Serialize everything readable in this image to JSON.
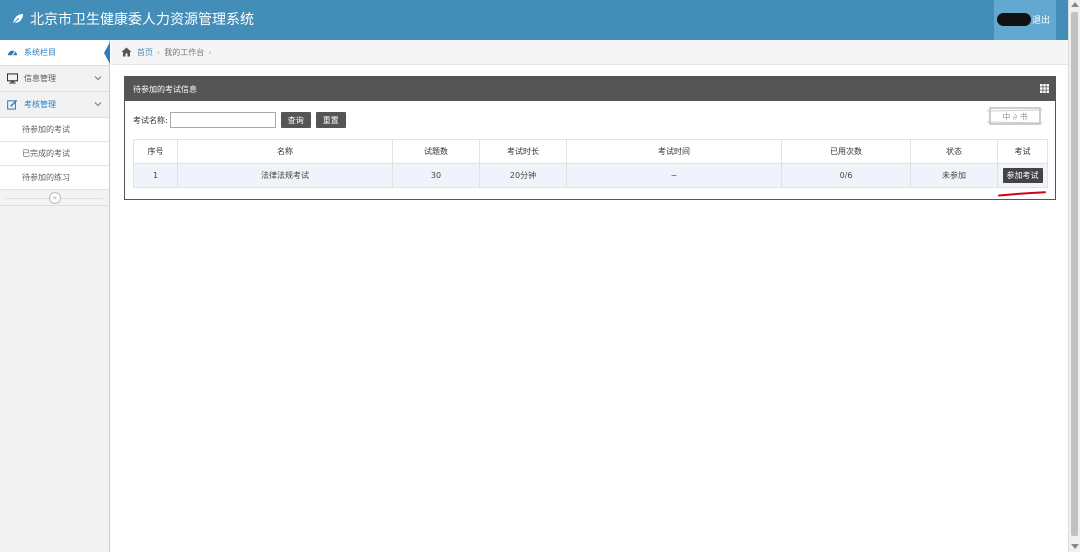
{
  "header": {
    "title": "北京市卫生健康委人力资源管理系统",
    "logout_label": "退出",
    "brand_icon": "leaf-icon",
    "colors": {
      "header_bg": "#438eb9",
      "user_area_bg": "#62a8d1"
    }
  },
  "sidebar": {
    "items": [
      {
        "label": "系统栏目",
        "icon": "dashboard-icon",
        "active": true
      },
      {
        "label": "信息管理",
        "icon": "desktop-icon"
      },
      {
        "label": "考核管理",
        "icon": "edit-icon",
        "open": true
      }
    ],
    "sub_items": [
      {
        "label": "待参加的考试"
      },
      {
        "label": "已完成的考试"
      },
      {
        "label": "待参加的练习"
      }
    ],
    "collapse_glyph": "«"
  },
  "breadcrumb": {
    "home": "首页",
    "current": "我的工作台",
    "sep": "›"
  },
  "panel": {
    "title": "待参加的考试信息",
    "search_label": "考试名称:",
    "search_value": "",
    "query_button": "查询",
    "reset_button": "重置",
    "stamp_text": "中 ∂ 书",
    "columns": [
      "序号",
      "名称",
      "试题数",
      "考试时长",
      "考试时间",
      "已用次数",
      "状态",
      "考试"
    ],
    "rows": [
      {
        "index": "1",
        "name": "法律法规考试",
        "question_count": "30",
        "duration": "20分钟",
        "time": "~",
        "used": "0/6",
        "status": "未参加",
        "action": "参加考试"
      }
    ],
    "colors": {
      "panel_head": "#555555",
      "row_bg": "#eef4f9",
      "annotation": "#d0021b"
    }
  }
}
